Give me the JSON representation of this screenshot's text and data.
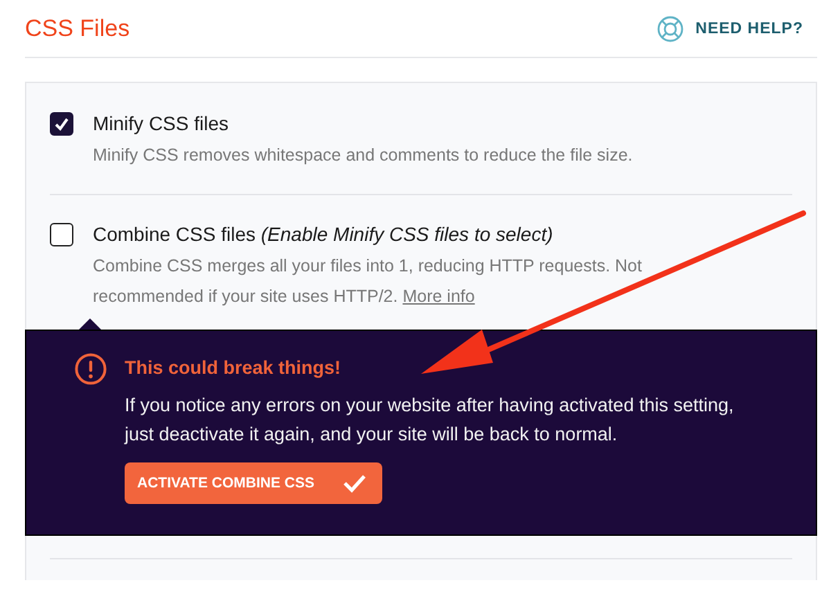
{
  "header": {
    "title": "CSS Files",
    "help_link": "NEED HELP?"
  },
  "options": [
    {
      "label": "Minify CSS files",
      "checked": true,
      "description": "Minify CSS removes whitespace and comments to reduce the file size."
    },
    {
      "label": "Combine CSS files *(Enable Minify CSS files to select)*",
      "checked": false,
      "description": "Combine CSS merges all your files into 1, reducing HTTP requests. Not recommended if your site uses HTTP/2.",
      "link": "More info"
    }
  ],
  "warning": {
    "title": "This could break things!",
    "message": "If you notice any errors on your website after having activated this setting, just deactivate it again, and your site will be back to normal.",
    "button": "ACTIVATE COMBINE CSS"
  }
}
